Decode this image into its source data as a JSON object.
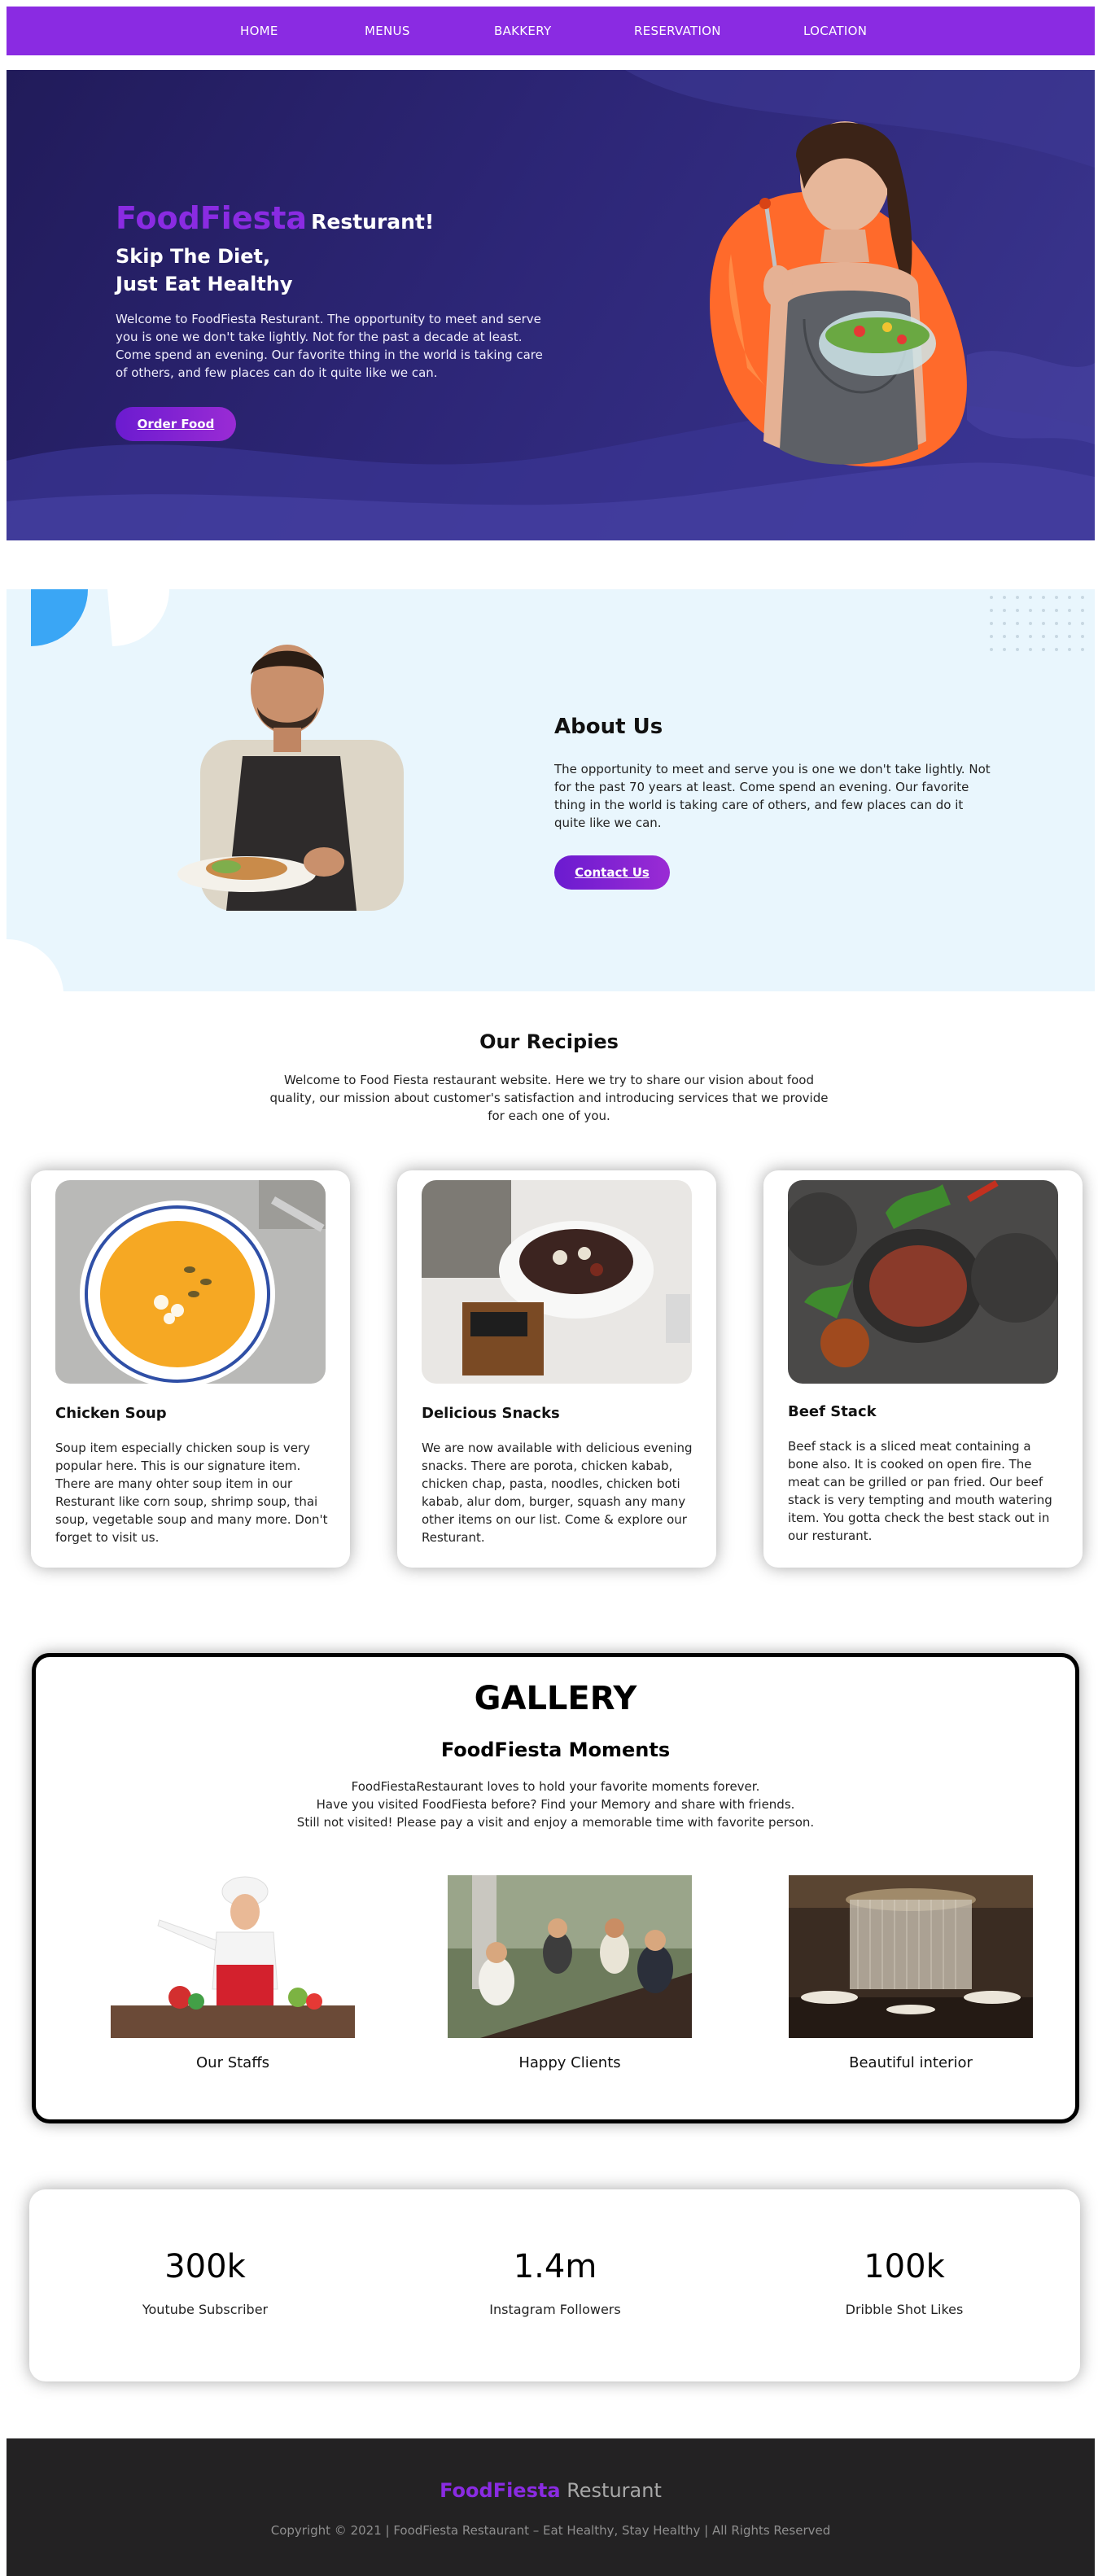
{
  "colors": {
    "accent": "#8a2be2",
    "hero_bg": "#2d2677",
    "about_bg": "#e9f6fd",
    "footer_bg": "#232223"
  },
  "nav": {
    "items": [
      {
        "label": "HOME"
      },
      {
        "label": "MENUS"
      },
      {
        "label": "BAKKERY"
      },
      {
        "label": "RESERVATION"
      },
      {
        "label": "LOCATION"
      }
    ]
  },
  "hero": {
    "brand": "FoodFiesta",
    "brand_suffix": "Resturant!",
    "tagline_line1": "Skip The Diet,",
    "tagline_line2": "Just Eat Healthy",
    "text": "Welcome to FoodFiesta Resturant. The opportunity to meet and serve you is one we don't take lightly. Not for the past a decade at least. Come spend an evening. Our favorite thing in the world is taking care of others, and few places can do it quite like we can.",
    "button": "Order Food"
  },
  "about": {
    "title": "About Us",
    "text": "The opportunity to meet and serve you is one we don't take lightly. Not for the past 70 years at least. Come spend an evening. Our favorite thing in the world is taking care of others, and few places can do it quite like we can.",
    "button": "Contact Us"
  },
  "recipes": {
    "title": "Our Recipies",
    "intro": "Welcome to Food Fiesta restaurant website. Here we try to share our vision about food quality, our mission about customer's satisfaction and introducing services that we provide for each one of you.",
    "cards": [
      {
        "title": "Chicken Soup",
        "text": "Soup item especially chicken soup is very popular here. This is our signature item. There are many ohter soup item in our Resturant like corn soup, shrimp soup, thai soup, vegetable soup and many more. Don't forget to visit us."
      },
      {
        "title": "Delicious Snacks",
        "text": "We are now available with delicious evening snacks. There are porota, chicken kabab, chicken chap, pasta, noodles, chicken boti kabab, alur dom, burger, squash any many other items on our list. Come & explore our Resturant."
      },
      {
        "title": "Beef Stack",
        "text": "Beef stack is a sliced meat containing a bone also. It is cooked on open fire. The meat can be grilled or pan fried. Our beef stack is very tempting and mouth watering item. You gotta check the best stack out in our resturant."
      }
    ]
  },
  "gallery": {
    "title": "GALLERY",
    "subtitle": "FoodFiesta Moments",
    "text_line1": "FoodFiestaRestaurant loves to hold your favorite moments forever.",
    "text_line2": "Have you visited FoodFiesta before? Find your Memory and share with friends.",
    "text_line3": "Still not visited! Please pay a visit and enjoy a memorable time with favorite person.",
    "items": [
      {
        "label": "Our Staffs"
      },
      {
        "label": "Happy Clients"
      },
      {
        "label": "Beautiful interior"
      }
    ]
  },
  "stats": [
    {
      "value": "300k",
      "label": "Youtube Subscriber"
    },
    {
      "value": "1.4m",
      "label": "Instagram Followers"
    },
    {
      "value": "100k",
      "label": "Dribble Shot Likes"
    }
  ],
  "footer": {
    "brand": "FoodFiesta",
    "brand_suffix": "Resturant",
    "copyright": "Copyright © 2021 | FoodFiesta Restaurant – Eat Healthy, Stay Healthy | All Rights Reserved"
  }
}
